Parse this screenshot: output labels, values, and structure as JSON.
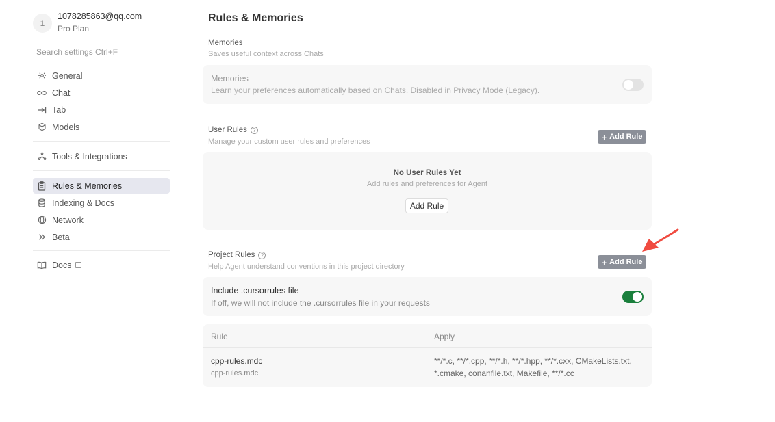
{
  "user": {
    "avatar_initial": "1",
    "email": "1078285863@qq.com",
    "plan": "Pro Plan"
  },
  "search": {
    "placeholder": "Search settings Ctrl+F"
  },
  "sidebar": {
    "items": [
      {
        "label": "General",
        "icon": "gear-icon"
      },
      {
        "label": "Chat",
        "icon": "infinity-icon"
      },
      {
        "label": "Tab",
        "icon": "arrow-right-bar-icon"
      },
      {
        "label": "Models",
        "icon": "cube-icon"
      },
      {
        "label": "Tools & Integrations",
        "icon": "nodes-icon"
      },
      {
        "label": "Rules & Memories",
        "icon": "clipboard-icon",
        "active": true
      },
      {
        "label": "Indexing & Docs",
        "icon": "database-icon"
      },
      {
        "label": "Network",
        "icon": "globe-icon"
      },
      {
        "label": "Beta",
        "icon": "double-chevron-icon"
      },
      {
        "label": "Docs",
        "icon": "book-icon"
      }
    ]
  },
  "main": {
    "title": "Rules & Memories",
    "memories": {
      "section_title": "Memories",
      "section_desc": "Saves useful context across Chats",
      "card_title": "Memories",
      "card_desc": "Learn your preferences automatically based on Chats. Disabled in Privacy Mode (Legacy).",
      "toggle_on": false
    },
    "user_rules": {
      "section_title": "User Rules",
      "section_desc": "Manage your custom user rules and preferences",
      "add_button": "Add Rule",
      "empty_title": "No User Rules Yet",
      "empty_desc": "Add rules and preferences for Agent",
      "empty_button": "Add Rule"
    },
    "project_rules": {
      "section_title": "Project Rules",
      "section_desc": "Help Agent understand conventions in this project directory",
      "add_button": "Add Rule",
      "include_title": "Include .cursorrules file",
      "include_desc": "If off, we will not include the .cursorrules file in your requests",
      "toggle_on": true
    },
    "rules_table": {
      "columns": [
        "Rule",
        "Apply"
      ],
      "rows": [
        {
          "name": "cpp-rules.mdc",
          "path": "cpp-rules.mdc",
          "apply_line1": "**/*.c, **/*.cpp, **/*.h, **/*.hpp, **/*.cxx, CMakeLists.txt,",
          "apply_line2": "*.cmake, conanfile.txt, Makefile, **/*.cc"
        }
      ]
    }
  },
  "colors": {
    "accent_toggle_on": "#1a7f3c",
    "arrow": "#f04b40",
    "button_gray": "#8b8f98",
    "active_nav_bg": "#e6e7ef"
  }
}
